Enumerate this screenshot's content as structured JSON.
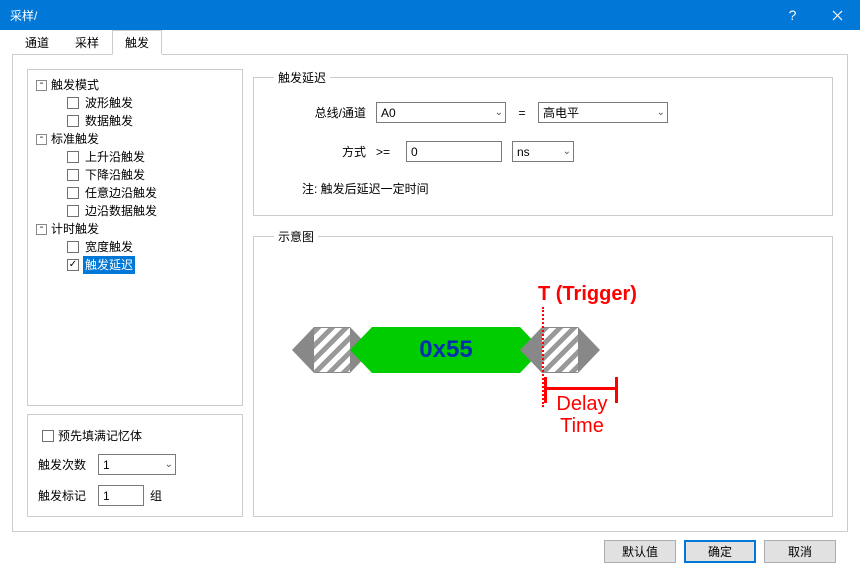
{
  "window": {
    "title": "采样/"
  },
  "tabs": [
    {
      "label": "通道"
    },
    {
      "label": "采样"
    },
    {
      "label": "触发"
    }
  ],
  "tree": {
    "modes": {
      "label": "触发模式",
      "items": [
        {
          "label": "波形触发"
        },
        {
          "label": "数据触发"
        }
      ]
    },
    "standard": {
      "label": "标准触发",
      "items": [
        {
          "label": "上升沿触发"
        },
        {
          "label": "下降沿触发"
        },
        {
          "label": "任意边沿触发"
        },
        {
          "label": "边沿数据触发"
        }
      ]
    },
    "timing": {
      "label": "计时触发",
      "items": [
        {
          "label": "宽度触发"
        },
        {
          "label": "触发延迟"
        }
      ]
    }
  },
  "lower": {
    "prefill_label": "预先填满记忆体",
    "count_label": "触发次数",
    "count_value": "1",
    "mark_label": "触发标记",
    "mark_value": "1",
    "mark_suffix": "组"
  },
  "delay_group": {
    "legend": "触发延迟",
    "bus_label": "总线/通道",
    "bus_value": "A0",
    "level_value": "高电平",
    "equals": "=",
    "mode_label": "方式",
    "mode_op": ">=",
    "mode_value": "0",
    "mode_unit": "ns",
    "note": "注: 触发后延迟一定时间"
  },
  "diagram": {
    "legend": "示意图",
    "data_label": "0x55",
    "trigger_label": "T (Trigger)",
    "delay_label_1": "Delay",
    "delay_label_2": "Time"
  },
  "buttons": {
    "defaults": "默认值",
    "ok": "确定",
    "cancel": "取消"
  }
}
